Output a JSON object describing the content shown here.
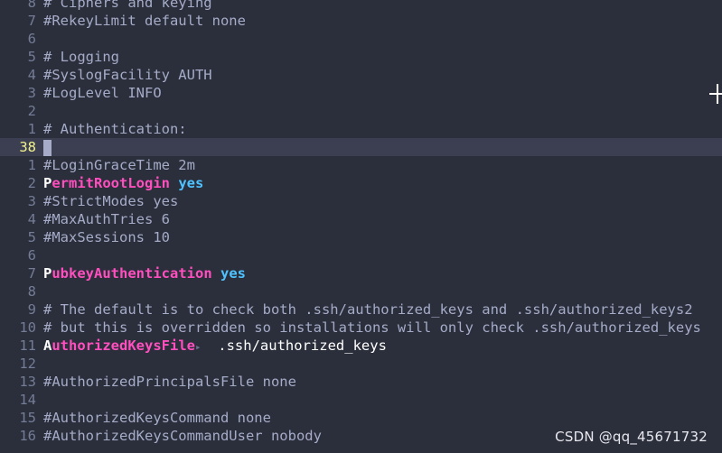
{
  "editor": {
    "lines": [
      {
        "num": "8",
        "text": "# Ciphers and keying"
      },
      {
        "num": "7",
        "text": "#RekeyLimit default none"
      },
      {
        "num": "6",
        "text": ""
      },
      {
        "num": "5",
        "text": "# Logging"
      },
      {
        "num": "4",
        "text": "#SyslogFacility AUTH"
      },
      {
        "num": "3",
        "text": "#LogLevel INFO"
      },
      {
        "num": "2",
        "text": ""
      },
      {
        "num": "1",
        "text": "# Authentication:"
      },
      {
        "num": "38",
        "text": ""
      },
      {
        "num": "1",
        "text": "#LoginGraceTime 2m"
      },
      {
        "num": "2",
        "key_first": "P",
        "key_rest": "ermitRootLogin",
        "value": "yes"
      },
      {
        "num": "3",
        "text": "#StrictModes yes"
      },
      {
        "num": "4",
        "text": "#MaxAuthTries 6"
      },
      {
        "num": "5",
        "text": "#MaxSessions 10"
      },
      {
        "num": "6",
        "text": ""
      },
      {
        "num": "7",
        "key_first": "P",
        "key_rest": "ubkeyAuthentication",
        "value": "yes"
      },
      {
        "num": "8",
        "text": ""
      },
      {
        "num": "9",
        "text": "# The default is to check both .ssh/authorized_keys and .ssh/authorized_keys2"
      },
      {
        "num": "10",
        "text": "# but this is overridden so installations will only check .ssh/authorized_keys"
      },
      {
        "num": "11",
        "key_first": "A",
        "key_rest": "uthorizedKeysFile",
        "tab": "▸",
        "value": "  .ssh/authorized_keys"
      },
      {
        "num": "12",
        "text": ""
      },
      {
        "num": "13",
        "text": "#AuthorizedPrincipalsFile none"
      },
      {
        "num": "14",
        "text": ""
      },
      {
        "num": "15",
        "text": "#AuthorizedKeysCommand none"
      },
      {
        "num": "16",
        "text": "#AuthorizedKeysCommandUser nobody"
      }
    ]
  },
  "watermark": "CSDN @qq_45671732",
  "colors": {
    "background": "#2b2e3b",
    "current_line": "#3b3f51",
    "current_line_number": "#f2f28c",
    "keyword": "#ff4fbf",
    "value": "#4fc3ff",
    "comment": "#a6acc8"
  }
}
